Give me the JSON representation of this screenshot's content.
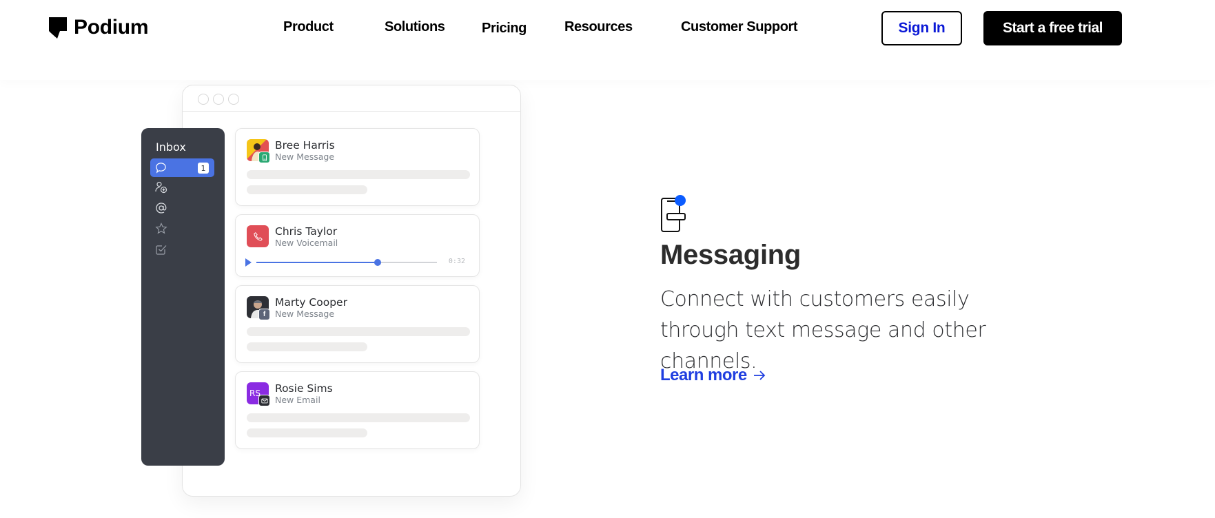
{
  "header": {
    "brand": "Podium",
    "nav": [
      {
        "label": "Product"
      },
      {
        "label": "Solutions"
      },
      {
        "label": "Pricing"
      },
      {
        "label": "Resources"
      },
      {
        "label": "Customer Support"
      }
    ],
    "sign_in_label": "Sign In",
    "trial_label": "Start a free trial",
    "colors": {
      "sign_in_text": "#0a18d6",
      "trial_bg": "#000000"
    }
  },
  "mockup": {
    "sidebar": {
      "title": "Inbox",
      "items": [
        {
          "icon": "chat-bubble-icon",
          "active": true,
          "badge": "1"
        },
        {
          "icon": "add-contact-icon",
          "active": false
        },
        {
          "icon": "at-sign-icon",
          "active": false
        },
        {
          "icon": "star-icon",
          "active": false
        },
        {
          "icon": "checkbox-icon",
          "active": false
        }
      ]
    },
    "conversations": [
      {
        "name": "Bree Harris",
        "subtitle": "New Message",
        "channel": "sms-icon",
        "channel_color": "#2aa872",
        "avatar_type": "photo"
      },
      {
        "name": "Chris Taylor",
        "subtitle": "New Voicemail",
        "channel": "phone-icon",
        "channel_color": "#e04e57",
        "avatar_type": "icon",
        "voicemail": {
          "duration": "0:32",
          "progress": 0.67
        }
      },
      {
        "name": "Marty Cooper",
        "subtitle": "New Message",
        "channel": "facebook-icon",
        "channel_color": "#5c6478",
        "avatar_type": "photo"
      },
      {
        "name": "Rosie Sims",
        "subtitle": "New Email",
        "channel": "email-icon",
        "channel_color": "#2b2d33",
        "avatar_type": "initials",
        "initials": "RS",
        "avatar_color": "#8a2be2"
      }
    ]
  },
  "feature": {
    "icon": "phone-message-icon",
    "title": "Messaging",
    "description": "Connect with customers easily through text message and other channels.",
    "link_label": "Learn more",
    "link_color": "#1f3ee0",
    "accent_dot_color": "#0b5cff"
  }
}
